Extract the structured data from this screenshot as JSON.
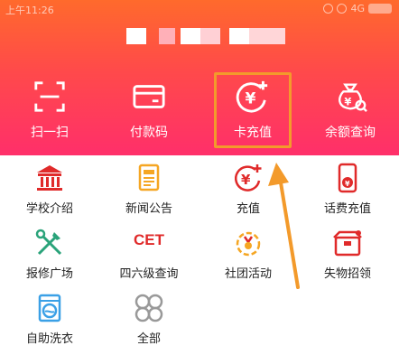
{
  "status_bar": {
    "time": "上午11:26",
    "network": "4G"
  },
  "quick_actions": [
    {
      "label": "扫一扫",
      "icon": "scan-icon"
    },
    {
      "label": "付款码",
      "icon": "payment-card-icon"
    },
    {
      "label": "卡充值",
      "icon": "yuan-plus-icon"
    },
    {
      "label": "余额查询",
      "icon": "money-bag-icon"
    }
  ],
  "services": [
    {
      "label": "学校介绍",
      "icon": "school-building-icon"
    },
    {
      "label": "新闻公告",
      "icon": "news-icon"
    },
    {
      "label": "充值",
      "icon": "yuan-plus-icon"
    },
    {
      "label": "话费充值",
      "icon": "phone-recharge-icon"
    },
    {
      "label": "报修广场",
      "icon": "repair-tools-icon"
    },
    {
      "label": "四六级查询",
      "icon": "cet-icon",
      "icon_text": "CET"
    },
    {
      "label": "社团活动",
      "icon": "club-activity-icon"
    },
    {
      "label": "失物招领",
      "icon": "lost-found-box-icon"
    },
    {
      "label": "自助洗衣",
      "icon": "washing-machine-icon"
    },
    {
      "label": "全部",
      "icon": "all-apps-icon"
    }
  ],
  "colors": {
    "header_top": "#ff6a2c",
    "header_bottom": "#ff2f6a",
    "highlight": "#f39a2b",
    "red_icon": "#e02a2a",
    "orange_icon": "#f5a623",
    "blue_icon": "#3aa0e6",
    "green_icon": "#2aa37a"
  }
}
